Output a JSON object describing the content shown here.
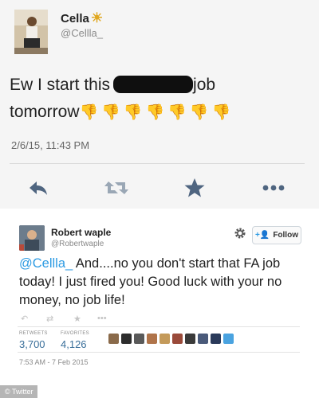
{
  "tweet1": {
    "name": "Cella",
    "handle": "@Cellla_",
    "text_before": "Ew I start this",
    "text_after": "job",
    "text_line2": "tomorrow",
    "thumbs": "👎👎👎👎👎👎👎",
    "timestamp": "2/6/15, 11:43 PM",
    "actions": [
      "reply-icon",
      "retweet-icon",
      "favorite-icon",
      "more-icon"
    ]
  },
  "tweet2": {
    "name": "Robert waple",
    "handle": "@Robertwaple",
    "follow_label": "Follow",
    "mention": "@Cellla_",
    "text": " And....no you don't start that FA job today!  I just fired you!  Good luck with your no money, no job life!",
    "stats": {
      "retweets_label": "RETWEETS",
      "retweets": "3,700",
      "favorites_label": "FAVORITES",
      "favorites": "4,126"
    },
    "timestamp": "7:53 AM - 7 Feb 2015"
  },
  "watermark": "© Twitter",
  "colors": {
    "link": "#2d9be3",
    "stat_value": "#3a6f9a",
    "action_icon": "#4f6580"
  }
}
